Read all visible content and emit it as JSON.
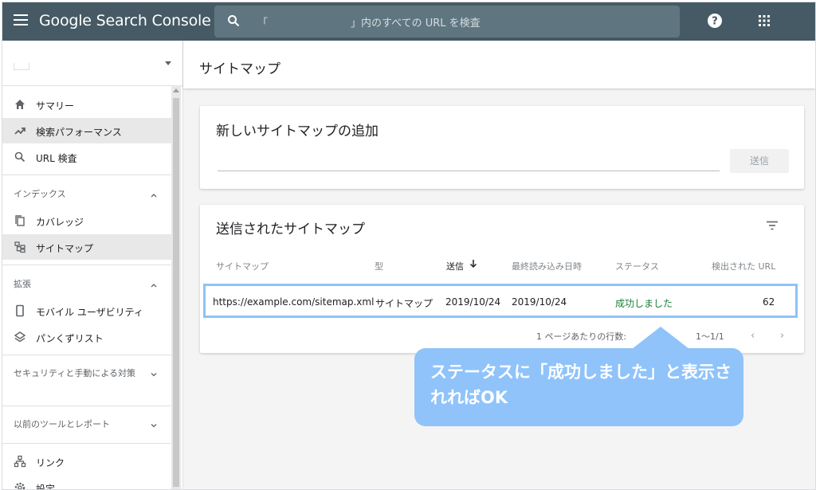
{
  "app": {
    "title": "Google Search Console"
  },
  "search": {
    "placeholder": "「　　　　　　　　」内のすべての URL を検査"
  },
  "sidebar": {
    "items_top": [
      {
        "label": "サマリー",
        "icon": "home-icon"
      },
      {
        "label": "検索パフォーマンス",
        "icon": "trending-up-icon",
        "active": true
      },
      {
        "label": "URL 検査",
        "icon": "search-icon"
      }
    ],
    "sections": [
      {
        "heading": "インデックス",
        "items": [
          {
            "label": "カバレッジ",
            "icon": "copy-icon"
          },
          {
            "label": "サイトマップ",
            "icon": "sitemap-icon",
            "active": true
          }
        ]
      },
      {
        "heading": "拡張",
        "items": [
          {
            "label": "モバイル ユーザビリティ",
            "icon": "smartphone-icon"
          },
          {
            "label": "パンくずリスト",
            "icon": "layers-icon"
          }
        ]
      },
      {
        "heading": "セキュリティと手動による対策",
        "items": []
      },
      {
        "heading": "以前のツールとレポート",
        "items": []
      }
    ],
    "items_bottom": [
      {
        "label": "リンク",
        "icon": "links-icon"
      },
      {
        "label": "設定",
        "icon": "settings-icon"
      }
    ]
  },
  "main": {
    "page_title": "サイトマップ",
    "add_card": {
      "title": "新しいサイトマップの追加",
      "submit_label": "送信"
    },
    "submitted_card": {
      "title": "送信されたサイトマップ",
      "columns": [
        "サイトマップ",
        "型",
        "送信",
        "最終読み込み日時",
        "ステータス",
        "検出された URL"
      ],
      "rows": [
        {
          "sitemap": "https://example.com/sitemap.xml",
          "type": "サイトマップ",
          "submitted": "2019/10/24",
          "last_read": "2019/10/24",
          "status": "成功しました",
          "urls": "62"
        }
      ],
      "rows_per_page_label": "1 ページあたりの行数:",
      "page_range": "1〜1/1"
    }
  },
  "callout": {
    "text": "ステータスに「成功しました」と表示されればOK"
  },
  "colors": {
    "topbar": "#455a64",
    "status_success": "#188038",
    "callout": "#8fc3fa",
    "highlight_border": "#90c2f8"
  }
}
